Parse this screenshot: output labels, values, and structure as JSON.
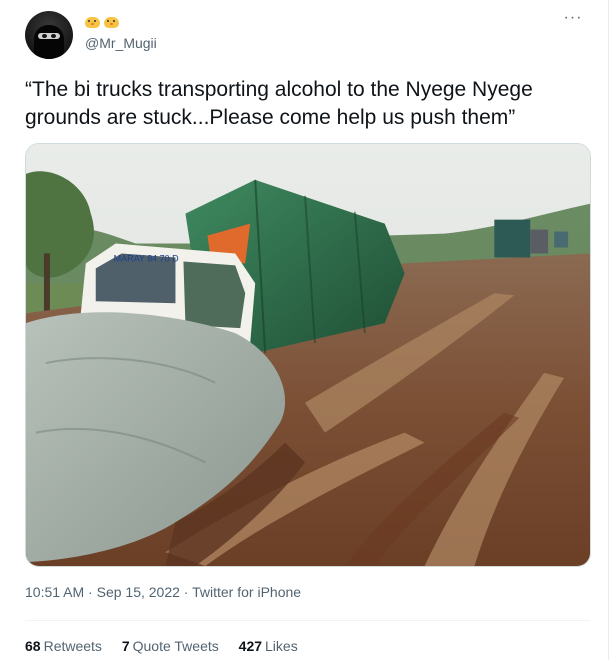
{
  "author": {
    "display_emoji": [
      "chick-emoji",
      "chick-emoji"
    ],
    "handle": "@Mr_Mugii"
  },
  "tweet": {
    "text": "“The bi trucks transporting alcohol to the Nyege Nyege grounds are stuck...Please come help us push them”",
    "photo_alt": "Trucks stuck in a muddy road",
    "truck_plate": "MARAY 84 70 D"
  },
  "meta": {
    "time": "10:51 AM",
    "separator": " · ",
    "date": "Sep 15, 2022",
    "source": "Twitter for iPhone"
  },
  "stats": {
    "retweets_count": "68",
    "retweets_label": "Retweets",
    "quote_count": "7",
    "quote_label": "Quote Tweets",
    "likes_count": "427",
    "likes_label": "Likes"
  },
  "icons": {
    "more": "more-options-icon",
    "avatar": "masked-person-avatar"
  },
  "colors": {
    "text": "#0f1419",
    "muted": "#536471",
    "border": "#cfd9de",
    "tarp_green": "#2f6f4a",
    "mud": "#8a5a3a"
  }
}
